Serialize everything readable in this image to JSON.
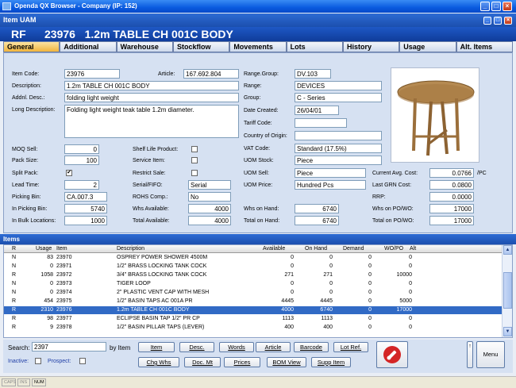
{
  "window": {
    "title": "Openda QX Browser  -  Company (IP: 152)"
  },
  "subwindow": {
    "title": "Item UAM"
  },
  "item_header": {
    "type": "RF",
    "code": "23976",
    "description": "1.2m TABLE CH 001C BODY"
  },
  "tabs": [
    "General",
    "Additional",
    "Warehouse",
    "Stockflow",
    "Movements",
    "Lots",
    "History",
    "Usage",
    "Alt. Items"
  ],
  "general": {
    "item_code": {
      "label": "Item Code:",
      "value": "23976"
    },
    "article": {
      "label": "Article:",
      "value": "167.692.804"
    },
    "description": {
      "label": "Description:",
      "value": "1.2m TABLE CH 001C BODY"
    },
    "addnl_desc": {
      "label": "Addnl. Desc.:",
      "value": "folding light weight"
    },
    "long_desc": {
      "label": "Long Description:",
      "value": "Folding light weight teak table 1.2m diameter."
    },
    "range_group": {
      "label": "Range.Group:",
      "value": "DV.103"
    },
    "range": {
      "label": "Range:",
      "value": "DEVICES"
    },
    "group": {
      "label": "Group:",
      "value": "C - Series"
    },
    "date_created": {
      "label": "Date Created:",
      "value": "26/04/01"
    },
    "tariff_code": {
      "label": "Tariff Code:",
      "value": ""
    },
    "country_origin": {
      "label": "Country of Origin:",
      "value": ""
    },
    "moq_sell": {
      "label": "MOQ Sell:",
      "value": "0"
    },
    "pack_size": {
      "label": "Pack Size:",
      "value": "100"
    },
    "split_pack": {
      "label": "Split Pack:",
      "checked": true
    },
    "lead_time": {
      "label": "Lead Time:",
      "value": "2"
    },
    "picking_bin": {
      "label": "Picking Bin:",
      "value": "CA.007.3"
    },
    "in_picking_bin": {
      "label": "In Picking Bin:",
      "value": "5740"
    },
    "in_bulk_locations": {
      "label": "In Bulk Locations:",
      "value": "1000"
    },
    "shelf_life_product": {
      "label": "Shelf Life Product:",
      "checked": false
    },
    "service_item": {
      "label": "Service Item:",
      "checked": false
    },
    "restrict_sale": {
      "label": "Restrict Sale:",
      "checked": false
    },
    "serial_fifo": {
      "label": "Serial/FIFO:",
      "value": "Serial"
    },
    "rohs_comp": {
      "label": "ROHS Comp.:",
      "value": "No"
    },
    "whs_available": {
      "label": "Whs Available:",
      "value": "4000"
    },
    "total_available": {
      "label": "Total Available:",
      "value": "4000"
    },
    "vat_code": {
      "label": "VAT Code:",
      "value": "Standard (17.5%)"
    },
    "uom_stock": {
      "label": "UOM Stock:",
      "value": "Piece"
    },
    "uom_sell": {
      "label": "UOM Sell:",
      "value": "Piece"
    },
    "uom_price": {
      "label": "UOM Price:",
      "value": "Hundred Pcs"
    },
    "whs_on_hand": {
      "label": "Whs on Hand:",
      "value": "6740"
    },
    "total_on_hand": {
      "label": "Total on Hand:",
      "value": "6740"
    },
    "current_avg_cost": {
      "label": "Current Avg. Cost:",
      "value": "0.0766",
      "unit": "/PC"
    },
    "last_grn_cost": {
      "label": "Last GRN Cost:",
      "value": "0.0800"
    },
    "rrp": {
      "label": "RRP:",
      "value": "0.0000"
    },
    "whs_on_po_wo": {
      "label": "Whs on PO/WO:",
      "value": "17000"
    },
    "total_on_po_wo": {
      "label": "Total on PO/WO:",
      "value": "17000"
    }
  },
  "items_panel": {
    "title": "Items",
    "columns": [
      "R",
      "Usage",
      "Item",
      "Description",
      "Available",
      "On Hand",
      "Demand",
      "WO/PO",
      "Alt"
    ],
    "rows": [
      [
        "N",
        "83",
        "23970",
        "OSPREY POWER SHOWER 4500M",
        "0",
        "0",
        "0",
        "0",
        ""
      ],
      [
        "N",
        "0",
        "23971",
        "1/2\" BRASS LOCKING TANK COCK",
        "0",
        "0",
        "0",
        "0",
        ""
      ],
      [
        "R",
        "1058",
        "23972",
        "3/4\" BRASS LOCKING TANK COCK",
        "271",
        "271",
        "0",
        "10000",
        ""
      ],
      [
        "N",
        "0",
        "23973",
        "TIGER LOOP",
        "0",
        "0",
        "0",
        "0",
        ""
      ],
      [
        "N",
        "0",
        "23974",
        "2\" PLASTIC VENT CAP WITH MESH",
        "0",
        "0",
        "0",
        "0",
        ""
      ],
      [
        "R",
        "454",
        "23975",
        "1/2\" BASIN TAPS AC 001A PR",
        "4445",
        "4445",
        "0",
        "5000",
        ""
      ],
      [
        "R",
        "2310",
        "23976",
        "1.2m TABLE CH 001C BODY",
        "4000",
        "6740",
        "0",
        "17000",
        ""
      ],
      [
        "R",
        "98",
        "23977",
        "ECLIPSE BASIN TAP 1/2\" PR CP",
        "1113",
        "1113",
        "0",
        "0",
        ""
      ],
      [
        "R",
        "9",
        "23978",
        "1/2\" BASIN PILLAR TAPS (LEVER)",
        "400",
        "400",
        "0",
        "0",
        ""
      ]
    ],
    "selected_index": 6
  },
  "search": {
    "label": "Search:",
    "value": "2397",
    "by_label": "by Item",
    "inactive_label": "Inactive:",
    "prospect_label": "Prospect:"
  },
  "buttons_row1": [
    "Item",
    "Desc.",
    "Words",
    "Article",
    "Barcode",
    "Lot Ref."
  ],
  "buttons_row2": [
    "Chg Whs",
    "Doc. Mt",
    "Prices",
    "BOM View",
    "Supp Item"
  ],
  "menu_button": "Menu",
  "status": [
    "CAPS",
    "INS",
    "NUM"
  ],
  "colors": {
    "title_blue": "#0a5adf",
    "tab_active": "#f1b43c",
    "selection": "#316ac5"
  }
}
